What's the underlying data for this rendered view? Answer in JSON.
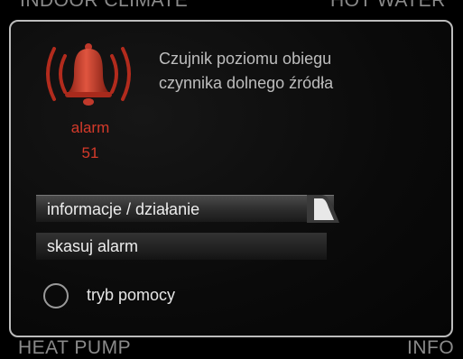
{
  "background": {
    "top_left": "INDOOR CLIMATE",
    "top_right": "HOT WATER",
    "bottom_left": "HEAT PUMP",
    "bottom_right": "INFO"
  },
  "alarm": {
    "icon": "alarm-bell-icon",
    "label": "alarm",
    "code": "51",
    "message_line1": "Czujnik poziomu obiegu",
    "message_line2": "czynnika dolnego źródła"
  },
  "menu": {
    "items": [
      {
        "label": "informacje / działanie",
        "selected": true
      },
      {
        "label": "skasuj alarm",
        "selected": false
      }
    ],
    "help": {
      "label": "tryb pomocy",
      "checked": false
    }
  },
  "colors": {
    "alarm_red": "#d43a2a",
    "bell_red": "#c0392b"
  }
}
